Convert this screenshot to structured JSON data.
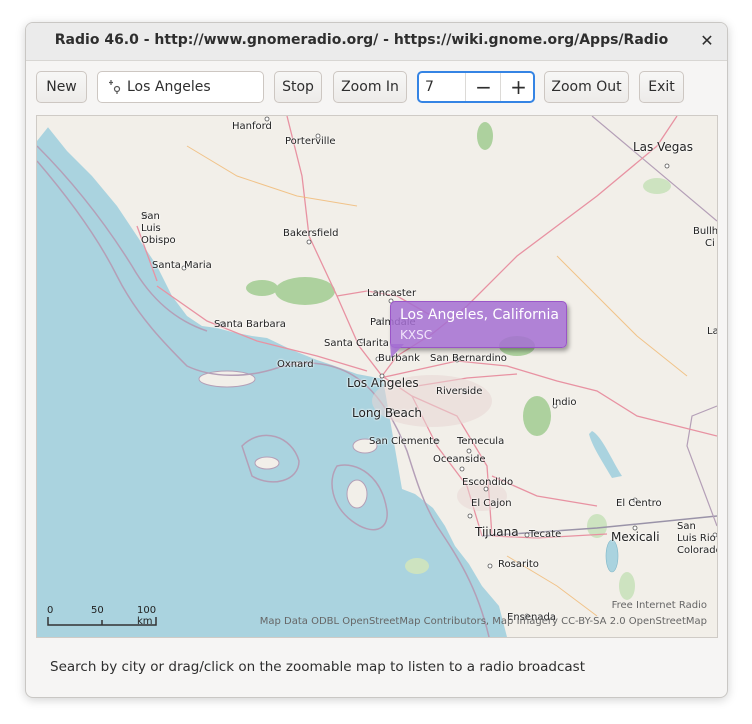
{
  "window": {
    "title": "Radio 46.0 - http://www.gnomeradio.org/ - https://wiki.gnome.org/Apps/Radio",
    "close_icon": "close-icon"
  },
  "toolbar": {
    "new_label": "New",
    "search_value": "Los Angeles",
    "search_icon": "location-icon",
    "stop_label": "Stop",
    "zoom_in_label": "Zoom In",
    "zoom_level": "7",
    "minus_symbol": "−",
    "plus_symbol": "+",
    "zoom_out_label": "Zoom Out",
    "exit_label": "Exit"
  },
  "map": {
    "cities": [
      "Hanford",
      "Porterville",
      "Las Vegas",
      "San Luis Obispo",
      "Bakersfield",
      "Santa Maria",
      "Lancaster",
      "Palmdale",
      "Santa Barbara",
      "Santa Clarita",
      "Burbank",
      "San Bernardino",
      "Oxnard",
      "Los Angeles",
      "Riverside",
      "Indio",
      "Long Beach",
      "San Clemente",
      "Temecula",
      "Oceanside",
      "Escondido",
      "El Cajon",
      "El Centro",
      "Tijuana",
      "Tecate",
      "Mexicali",
      "Rosarito",
      "Ensenada",
      "San Luis Rio Colorado",
      "Bullh",
      "Ci",
      "La"
    ],
    "popup": {
      "title": "Los Angeles, California",
      "station": "KXSC"
    },
    "scale": {
      "labels": [
        "0",
        "50",
        "100 km"
      ]
    },
    "credit": "Free Internet Radio",
    "attribution": "Map Data ODBL OpenStreetMap Contributors, Map Imagery CC-BY-SA 2.0 OpenStreetMap",
    "colors": {
      "water": "#aad3df",
      "land": "#f2efe9",
      "forest": "#add19e",
      "road": "#e892a2",
      "popup": "#a56ed2"
    }
  },
  "status": {
    "text": "Search by city or drag/click on the zoomable map to listen to a radio broadcast"
  }
}
